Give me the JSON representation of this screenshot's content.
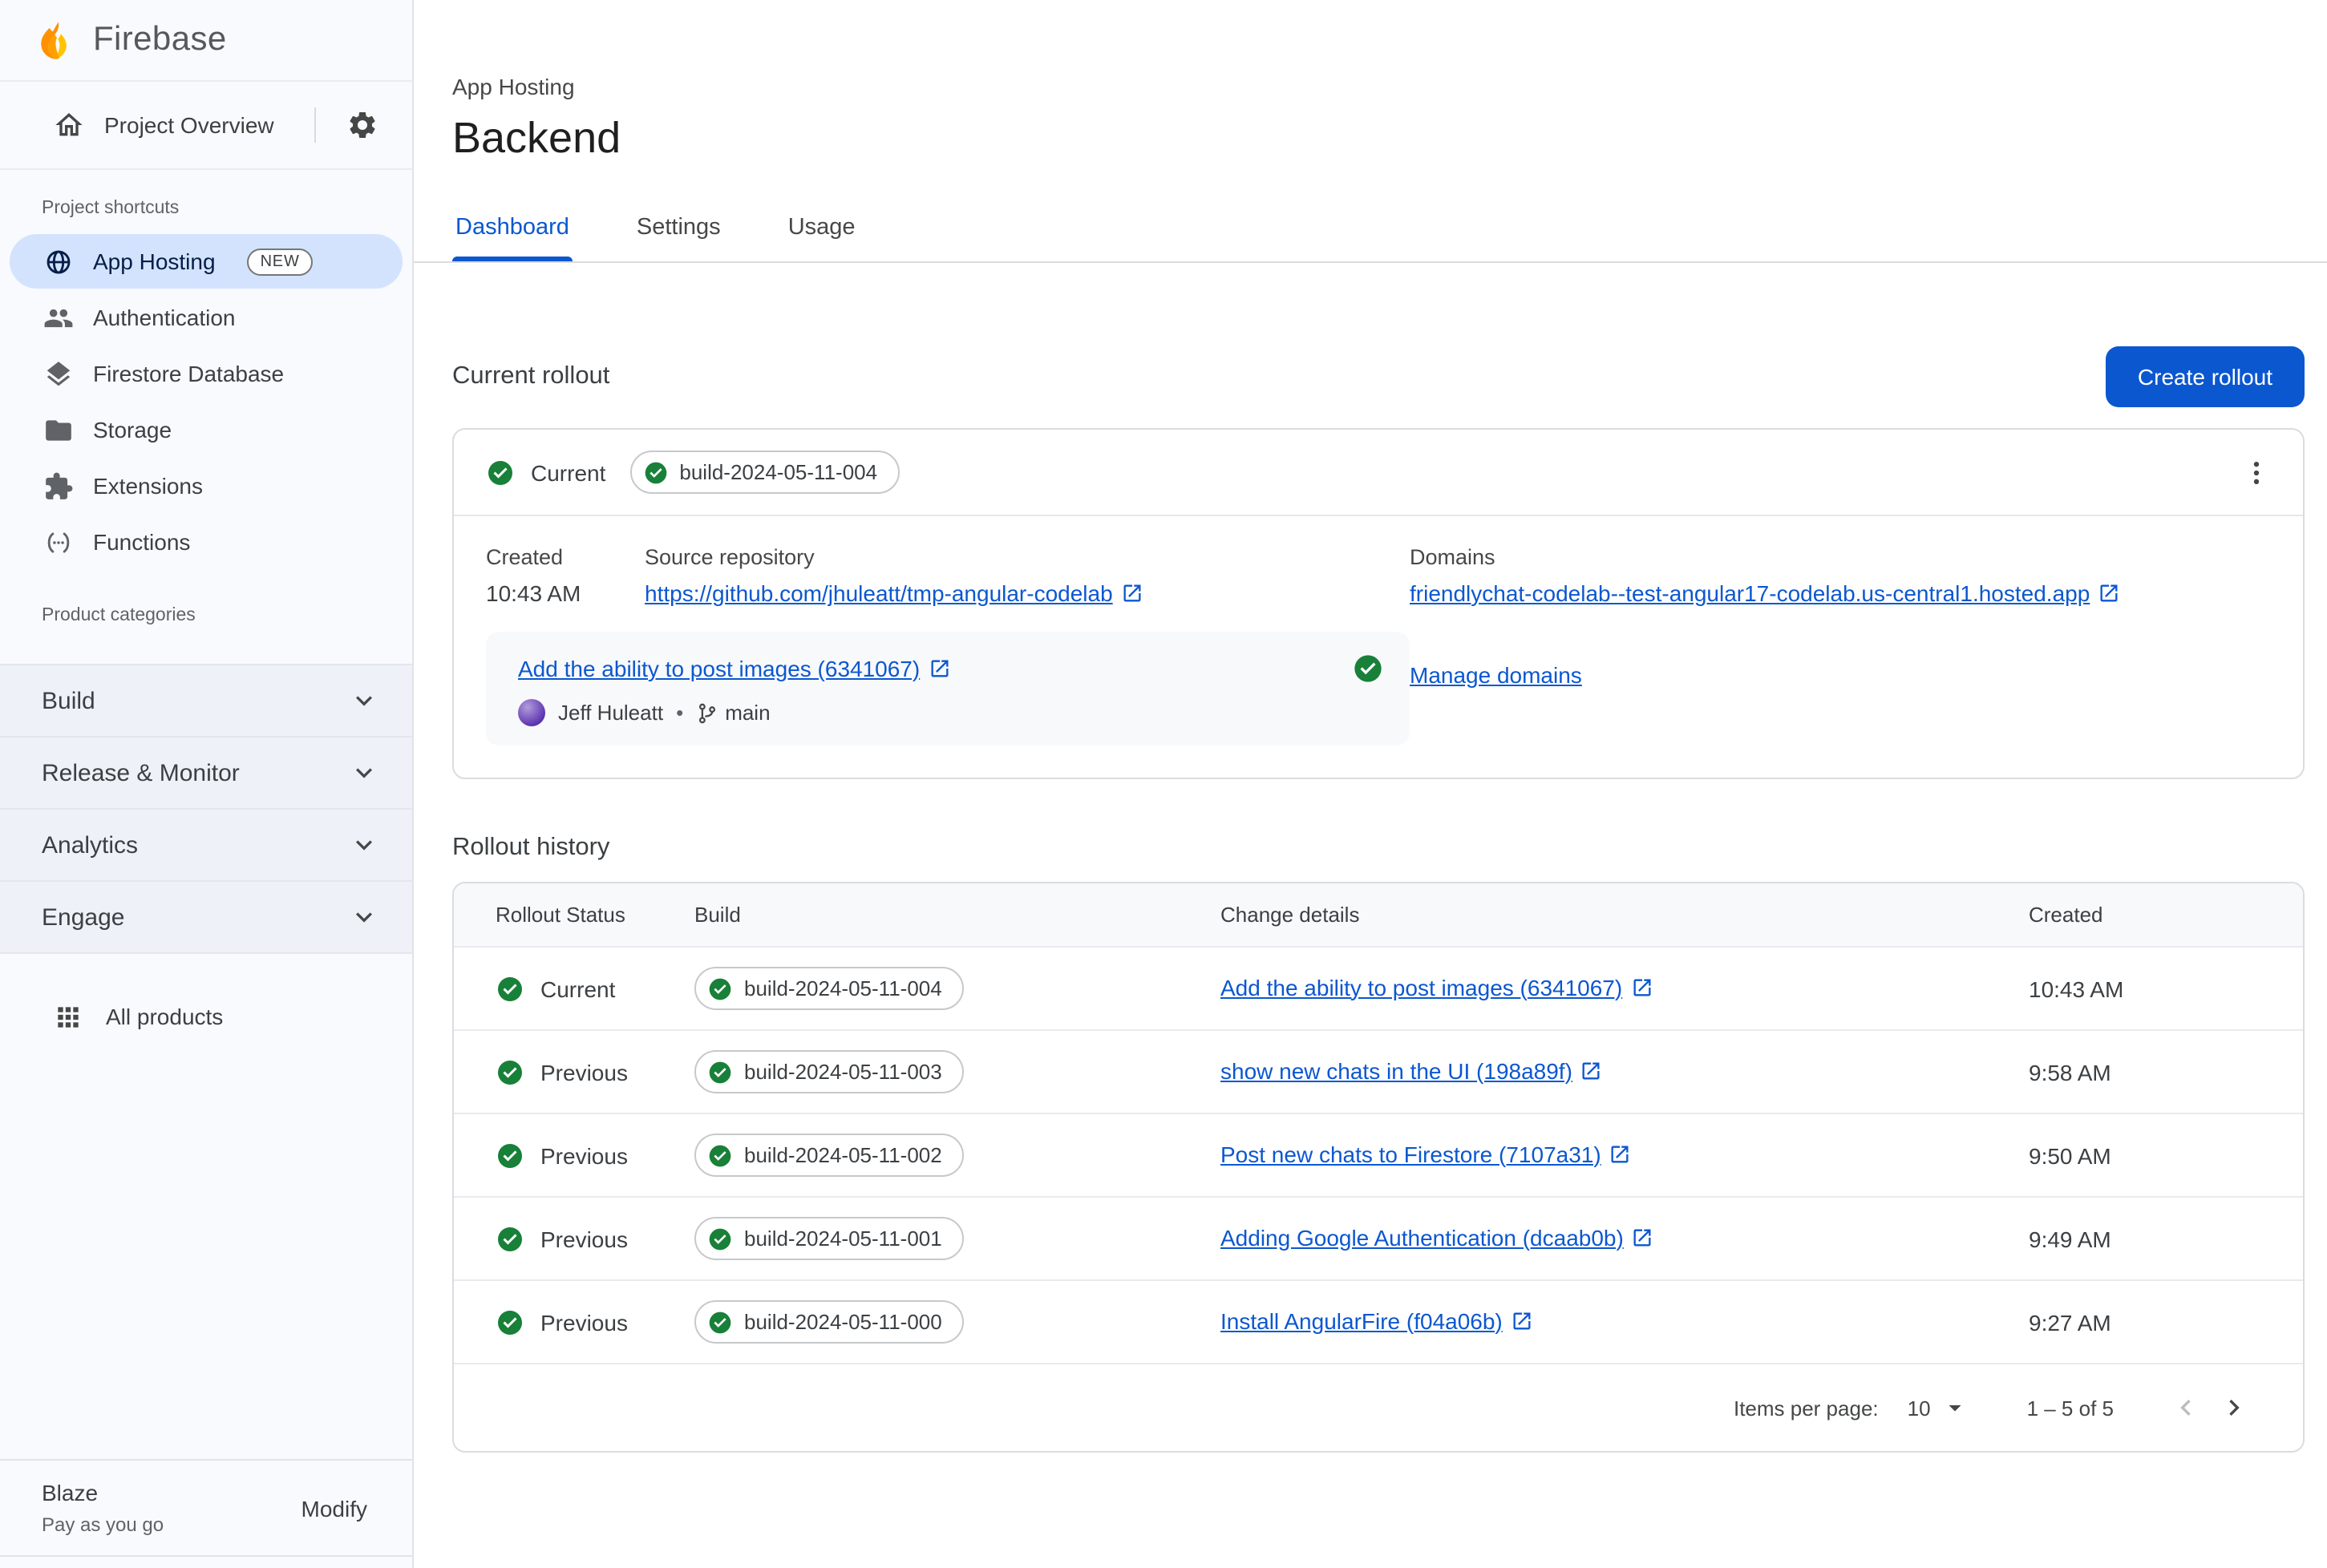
{
  "colors": {
    "accent": "#0b57d0",
    "success_green": "#188038",
    "selected_nav_bg": "#d3e3fd",
    "sidebar_bg": "#f8fafd",
    "flame_yellow": "#ffc400",
    "flame_orange": "#ff9100"
  },
  "sidebar": {
    "brand": "Firebase",
    "project_overview": "Project Overview",
    "shortcuts_label": "Project shortcuts",
    "categories_label": "Product categories",
    "shortcuts": [
      {
        "label": "App Hosting",
        "badge": "NEW"
      },
      {
        "label": "Authentication"
      },
      {
        "label": "Firestore Database"
      },
      {
        "label": "Storage"
      },
      {
        "label": "Extensions"
      },
      {
        "label": "Functions"
      }
    ],
    "categories": [
      {
        "label": "Build"
      },
      {
        "label": "Release & Monitor"
      },
      {
        "label": "Analytics"
      },
      {
        "label": "Engage"
      }
    ],
    "all_products": "All products",
    "plan": {
      "name": "Blaze",
      "description": "Pay as you go",
      "action": "Modify"
    }
  },
  "header": {
    "eyebrow": "App Hosting",
    "title": "Backend",
    "tabs": [
      {
        "label": "Dashboard"
      },
      {
        "label": "Settings"
      },
      {
        "label": "Usage"
      }
    ]
  },
  "current_rollout": {
    "title": "Current rollout",
    "create_button": "Create rollout",
    "status": "Current",
    "build": "build-2024-05-11-004",
    "created_label": "Created",
    "created": "10:43 AM",
    "source_label": "Source repository",
    "source": "https://github.com/jhuleatt/tmp-angular-codelab",
    "domains_label": "Domains",
    "domain": "friendlychat-codelab--test-angular17-codelab.us-central1.hosted.app",
    "manage_domains": "Manage domains",
    "commit": {
      "title": "Add the ability to post images (6341067)",
      "author": "Jeff Huleatt",
      "separator": "•",
      "branch": "main"
    }
  },
  "history": {
    "title": "Rollout history",
    "columns": [
      "Rollout Status",
      "Build",
      "Change details",
      "Created"
    ],
    "rows": [
      {
        "status": "Current",
        "build": "build-2024-05-11-004",
        "change": "Add the ability to post images (6341067)",
        "created": "10:43 AM"
      },
      {
        "status": "Previous",
        "build": "build-2024-05-11-003",
        "change": "show new chats in the UI (198a89f)",
        "created": "9:58 AM"
      },
      {
        "status": "Previous",
        "build": "build-2024-05-11-002",
        "change": "Post new chats to Firestore (7107a31)",
        "created": "9:50 AM"
      },
      {
        "status": "Previous",
        "build": "build-2024-05-11-001",
        "change": "Adding Google Authentication (dcaab0b)",
        "created": "9:49 AM"
      },
      {
        "status": "Previous",
        "build": "build-2024-05-11-000",
        "change": "Install AngularFire (f04a06b)",
        "created": "9:27 AM"
      }
    ],
    "pagination": {
      "label": "Items per page:",
      "value": "10",
      "range": "1 – 5 of 5"
    }
  }
}
